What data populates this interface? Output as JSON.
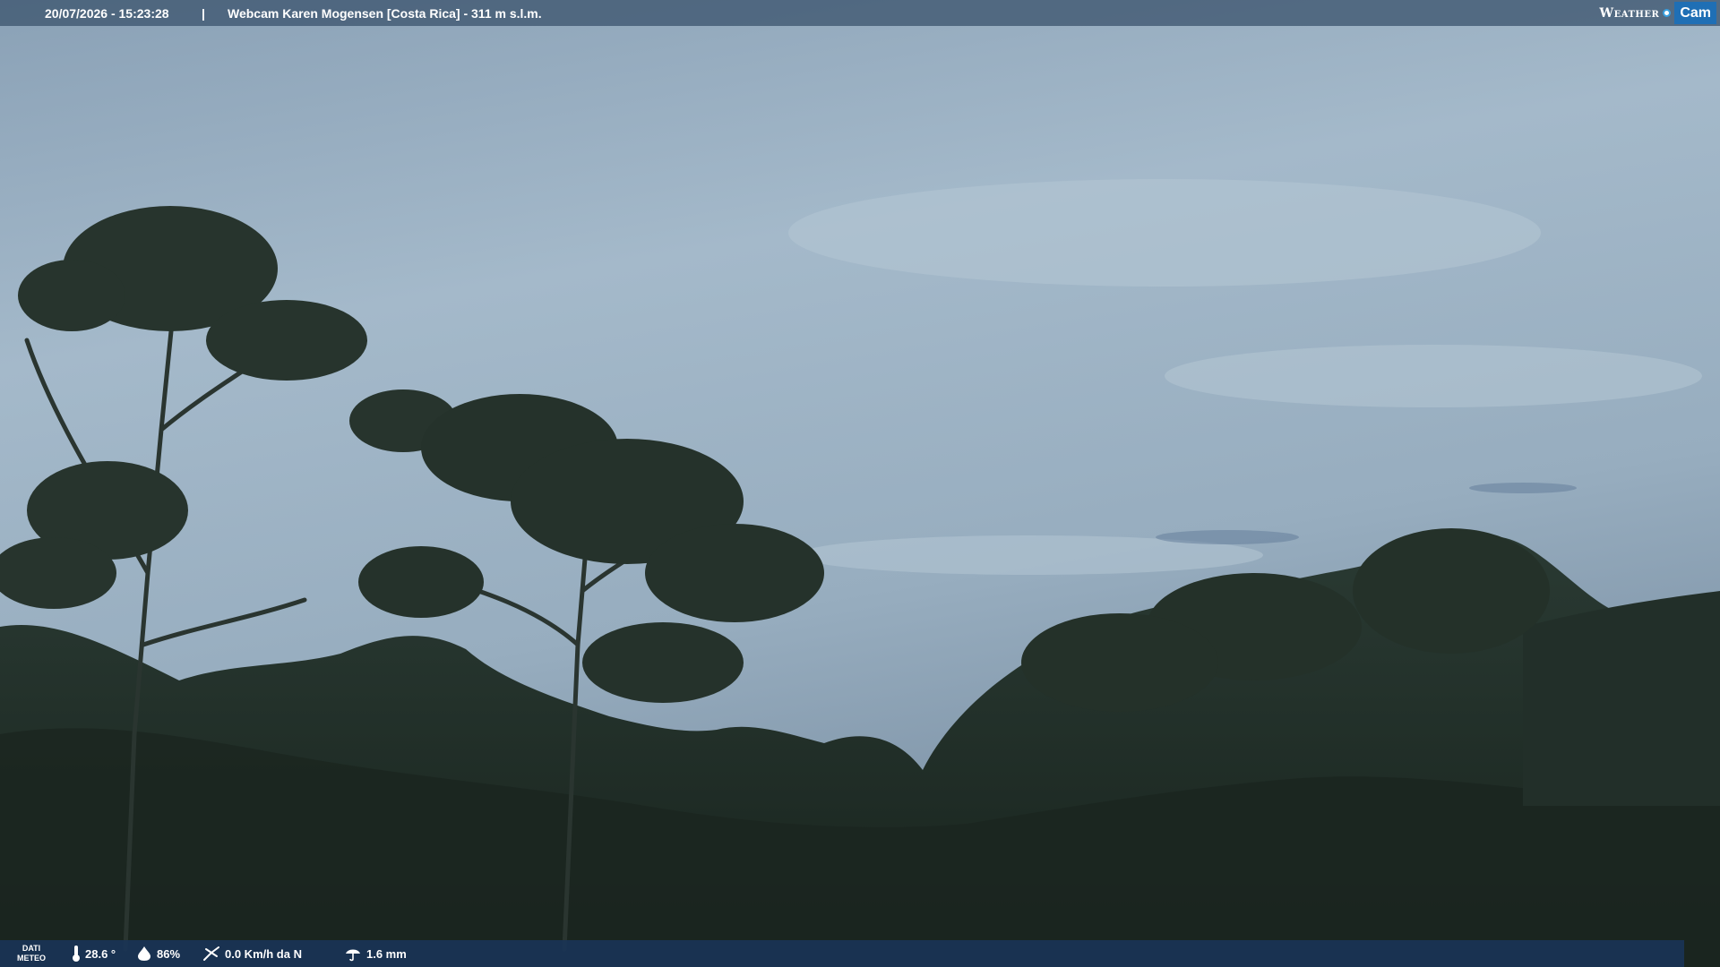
{
  "header": {
    "datetime": "20/07/2026 - 15:23:28",
    "separator": "|",
    "title": "Webcam Karen Mogensen [Costa Rica] - 311 m s.l.m.",
    "logo_weather": "Weather",
    "logo_cam": "Cam"
  },
  "weather_bar": {
    "label_line1": "DATI",
    "label_line2": "METEO",
    "temperature": "28.6 °",
    "humidity": "86%",
    "wind": "0.0 Km/h da N",
    "rain": "1.6 mm",
    "icons": [
      "thermometer-icon",
      "humidity-drop-icon",
      "wind-icon",
      "rain-icon"
    ]
  },
  "colors": {
    "sky_top": "#8ea6ba",
    "sky_mid": "#a3b8c9",
    "sky_bottom": "#7e93a6",
    "forest": "#1f2b24",
    "bar_top": "#3e5670",
    "bar_bottom": "#1a3456",
    "logo_blue": "#1f6fb5"
  }
}
